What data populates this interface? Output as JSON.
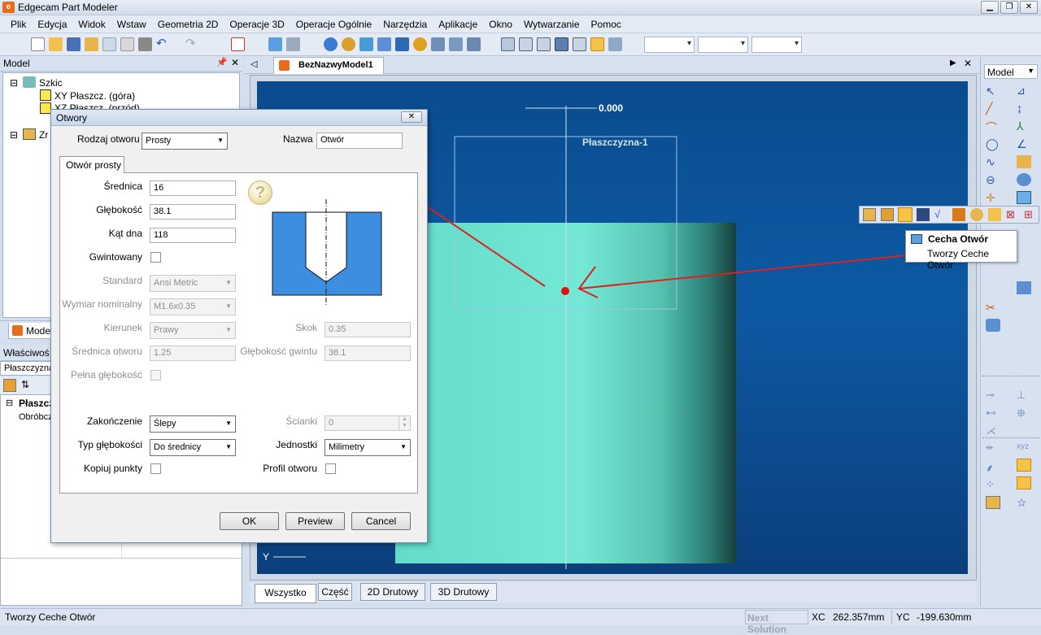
{
  "app": {
    "title": "Edgecam Part Modeler"
  },
  "menu": [
    "Plik",
    "Edycja",
    "Widok",
    "Wstaw",
    "Geometria 2D",
    "Operacje 3D",
    "Operacje Ogólnie",
    "Narzędzia",
    "Aplikacje",
    "Okno",
    "Wytwarzanie",
    "Pomoc"
  ],
  "model_panel": {
    "title": "Model",
    "tree": [
      "Szkic",
      "XY Płaszcz. (góra)",
      "XZ Płaszcz. (przód)",
      "Zr"
    ],
    "tab_label": "Mode",
    "props_title": "Właściwoś",
    "props_combo": "Płaszczyzna",
    "props_rows": [
      "Płaszcz",
      "Obróbcz"
    ]
  },
  "doc_tab": {
    "label": "BezNazwyModel1"
  },
  "viewport": {
    "dimension": "0.000",
    "plane_label": "Płaszczyzna-1",
    "axis_label": "Y"
  },
  "bottom_tabs": [
    "Wszystko",
    "Część",
    "2D Drutowy",
    "3D Drutowy"
  ],
  "status": {
    "message": "Tworzy Ceche Otwór",
    "next": "Next Solution",
    "xc_label": "XC",
    "xc_value": "262.357mm",
    "yc_label": "YC",
    "yc_value": "-199.630mm"
  },
  "right_panel": {
    "combo": "Model"
  },
  "tooltip": {
    "title": "Cecha Otwór",
    "desc": "Tworzy Ceche Otwór"
  },
  "dialog": {
    "title": "Otwory",
    "rodzaj_label": "Rodzaj otworu",
    "rodzaj_value": "Prosty",
    "nazwa_label": "Nazwa",
    "nazwa_value": "Otwór",
    "tab": "Otwór prosty",
    "srednica_label": "Średnica",
    "srednica_value": "16",
    "glebokosc_label": "Głębokość",
    "glebokosc_value": "38.1",
    "kat_label": "Kąt dna",
    "kat_value": "118",
    "gwint_label": "Gwintowany",
    "standard_label": "Standard",
    "standard_value": "Ansi Metric",
    "wymiar_label": "Wymiar nominalny",
    "wymiar_value": "M1.6x0.35",
    "kierunek_label": "Kierunek",
    "kierunek_value": "Prawy",
    "skok_label": "Skok",
    "skok_value": "0.35",
    "sred_otw_label": "Średnica otworu",
    "sred_otw_value": "1.25",
    "gleb_gwintu_label": "Głębokość gwintu",
    "gleb_gwintu_value": "38.1",
    "pelna_label": "Pełna głębokość",
    "zakonczenie_label": "Zakończenie",
    "zakonczenie_value": "Ślepy",
    "scianki_label": "Ścianki",
    "scianki_value": "0",
    "typ_label": "Typ głębokości",
    "typ_value": "Do średnicy",
    "jednostki_label": "Jednostki",
    "jednostki_value": "Milimetry",
    "kopiuj_label": "Kopiuj punkty",
    "profil_label": "Profil otworu",
    "ok": "OK",
    "preview": "Preview",
    "cancel": "Cancel",
    "help_glyph": "?"
  },
  "colors": {
    "accent": "#e76b1a",
    "viewport_bg": "#0d5aa3",
    "part": "#74e8d4",
    "annotation": "#e02020",
    "hole_fill": "#3d8de0"
  }
}
